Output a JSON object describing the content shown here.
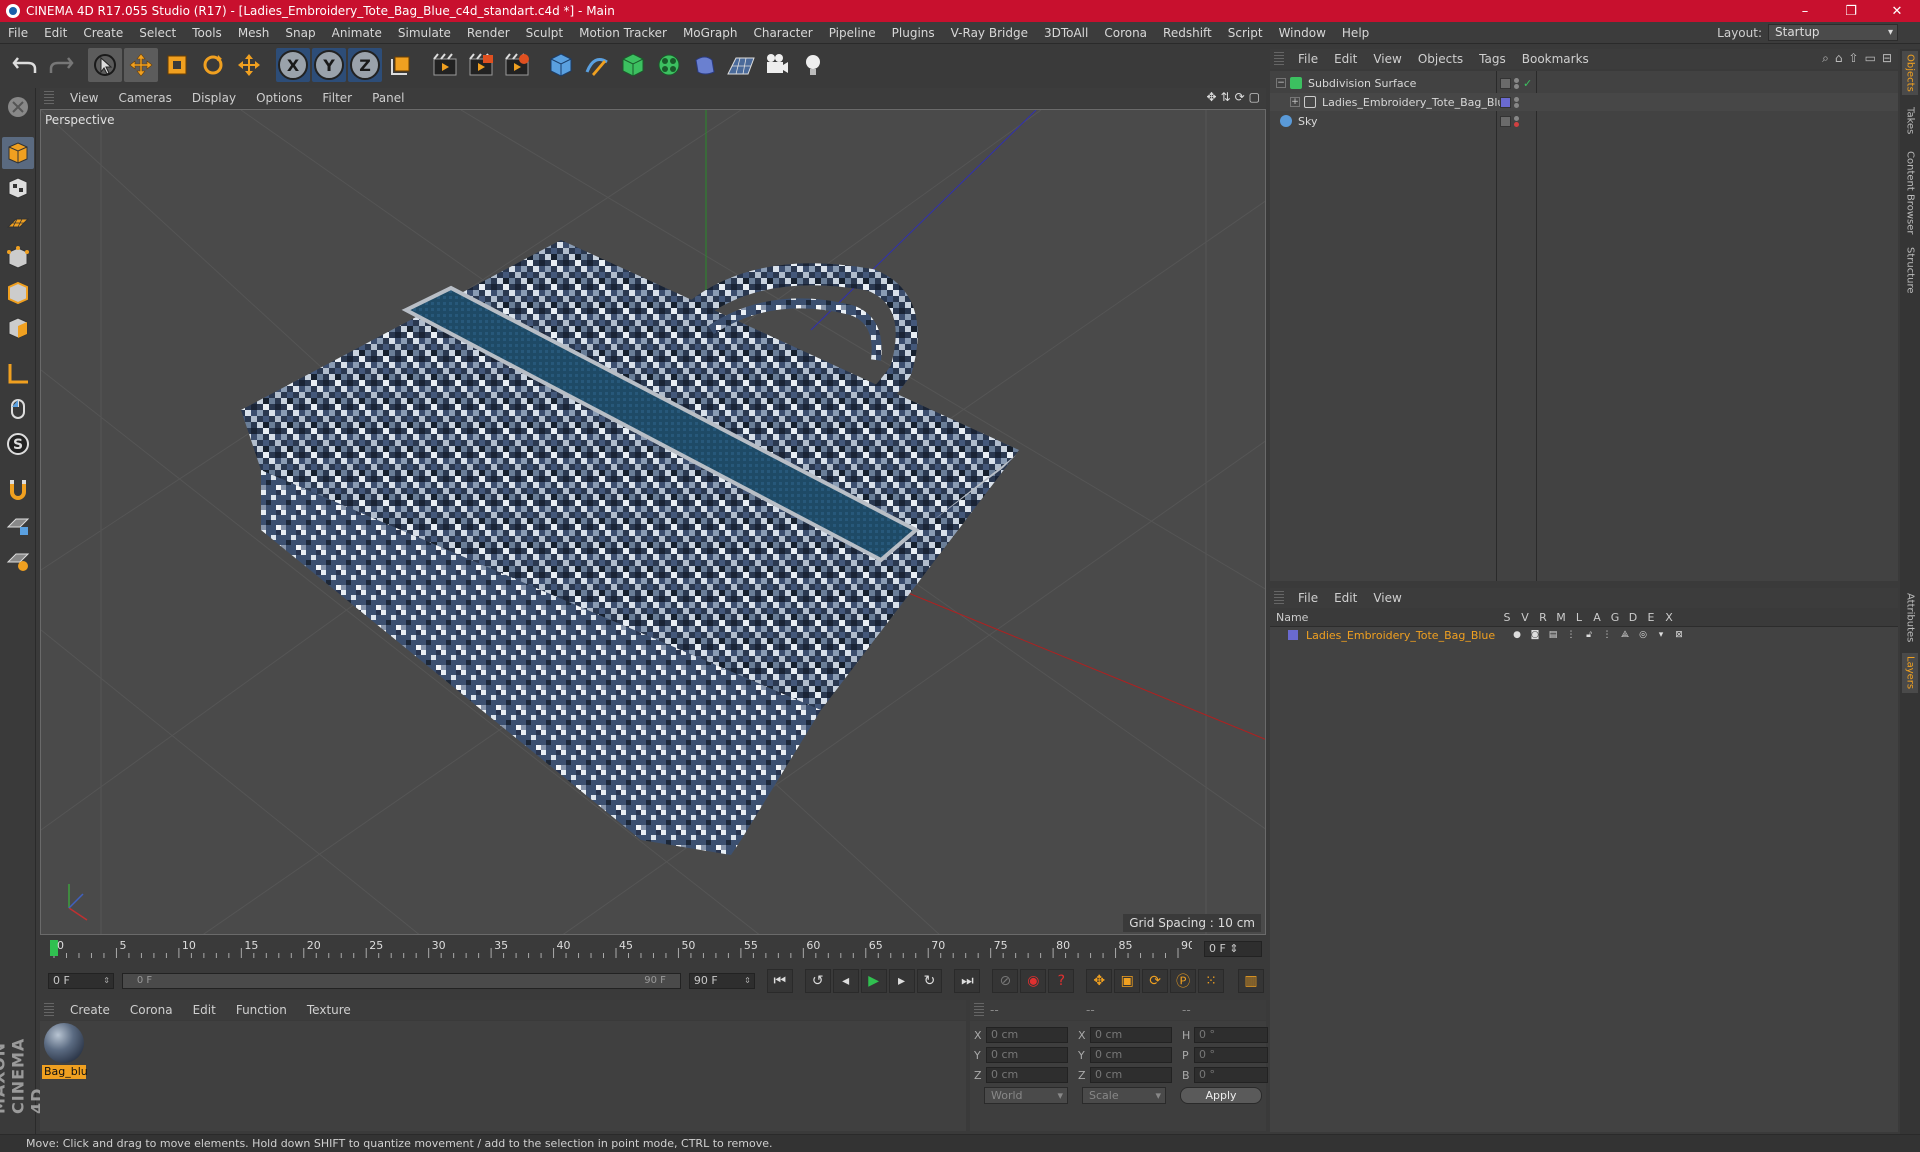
{
  "window": {
    "title": "CINEMA 4D R17.055 Studio (R17) - [Ladies_Embroidery_Tote_Bag_Blue_c4d_standart.c4d *] - Main",
    "controls": [
      "–",
      "❐",
      "✕"
    ]
  },
  "menubar": {
    "items": [
      "File",
      "Edit",
      "Create",
      "Select",
      "Tools",
      "Mesh",
      "Snap",
      "Animate",
      "Simulate",
      "Render",
      "Sculpt",
      "Motion Tracker",
      "MoGraph",
      "Character",
      "Pipeline",
      "Plugins",
      "V-Ray Bridge",
      "3DToAll",
      "Corona",
      "Redshift",
      "Script",
      "Window",
      "Help"
    ],
    "layout_label": "Layout:",
    "layout_value": "Startup"
  },
  "toolbar": {
    "axis_x": "X",
    "axis_y": "Y",
    "axis_z": "Z",
    "icons": [
      "undo-icon",
      "redo-icon",
      "select-icon",
      "move-icon",
      "scale-icon",
      "rotate-icon",
      "transform-icon",
      "coordinate-system-icon",
      "render-view-icon",
      "render-picture-viewer-icon",
      "edit-render-settings-icon",
      "cube-icon",
      "pen-icon",
      "subdivision-icon",
      "mograph-cloner-icon",
      "deformer-icon",
      "floor-icon",
      "camera-icon",
      "light-icon"
    ]
  },
  "viewport": {
    "menu": [
      "View",
      "Cameras",
      "Display",
      "Options",
      "Filter",
      "Panel"
    ],
    "label": "Perspective",
    "grid_spacing": "Grid Spacing : 10 cm"
  },
  "timeline": {
    "ticks": [
      "0",
      "5",
      "10",
      "15",
      "20",
      "25",
      "30",
      "35",
      "40",
      "45",
      "50",
      "55",
      "60",
      "65",
      "70",
      "75",
      "80",
      "85",
      "90"
    ],
    "current_frame": "0 F"
  },
  "transport": {
    "start_field": "0 F",
    "range_start": "0 F",
    "range_end": "90 F",
    "end_field": "90 F"
  },
  "material_manager": {
    "menu": [
      "Create",
      "Corona",
      "Edit",
      "Function",
      "Texture"
    ],
    "materials": [
      {
        "name": "Bag_blu"
      }
    ]
  },
  "coordinates": {
    "header": [
      "--",
      "--",
      "--"
    ],
    "rows": [
      {
        "axis1": "X",
        "val1": "0 cm",
        "axis2": "X",
        "val2": "0 cm",
        "axis3": "H",
        "val3": "0 °"
      },
      {
        "axis1": "Y",
        "val1": "0 cm",
        "axis2": "Y",
        "val2": "0 cm",
        "axis3": "P",
        "val3": "0 °"
      },
      {
        "axis1": "Z",
        "val1": "0 cm",
        "axis2": "Z",
        "val2": "0 cm",
        "axis3": "B",
        "val3": "0 °"
      }
    ],
    "mode1": "World",
    "mode2": "Scale",
    "apply": "Apply"
  },
  "object_manager": {
    "menu": [
      "File",
      "Edit",
      "View",
      "Objects",
      "Tags",
      "Bookmarks"
    ],
    "objects": [
      {
        "name": "Subdivision Surface",
        "icon": "subdivision-icon"
      },
      {
        "name": "Ladies_Embroidery_Tote_Bag_Blue",
        "icon": "null-object-icon"
      },
      {
        "name": "Sky",
        "icon": "sky-icon"
      }
    ]
  },
  "layer_manager": {
    "menu": [
      "File",
      "Edit",
      "View"
    ],
    "columns": [
      "Name",
      "S",
      "V",
      "R",
      "M",
      "L",
      "A",
      "G",
      "D",
      "E",
      "X"
    ],
    "layers": [
      {
        "name": "Ladies_Embroidery_Tote_Bag_Blue",
        "color": "#6a6ad0"
      }
    ]
  },
  "right_tabs": [
    "Objects",
    "Takes",
    "Content Browser",
    "Structure",
    "Attributes",
    "Layers"
  ],
  "status": "Move: Click and drag to move elements. Hold down SHIFT to quantize movement / add to the selection in point mode, CTRL to remove.",
  "colors": {
    "title_bar": "#c8102e",
    "accent_orange": "#f0a020",
    "panel": "#3a3a3a"
  },
  "branding": "MAXON CINEMA 4D"
}
